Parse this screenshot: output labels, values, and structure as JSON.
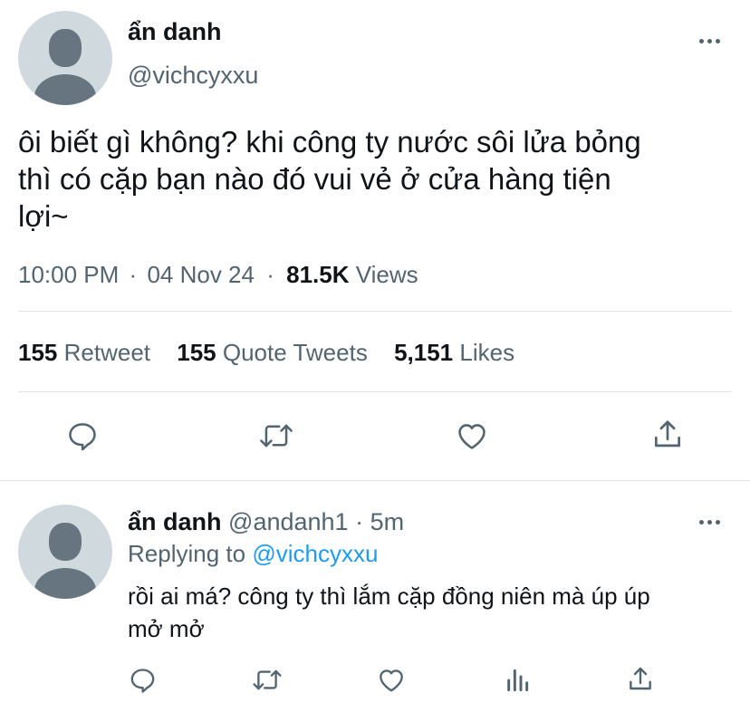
{
  "main_tweet": {
    "display_name": "ẩn danh",
    "handle": "@vichcyxxu",
    "text_line1": "ôi biết gì không? khi công ty nước sôi lửa bỏng",
    "text_line2": "thì có cặp bạn nào đó vui vẻ ở cửa hàng tiện",
    "text_line3": "lợi~",
    "time": "10:00 PM",
    "date": "04 Nov 24",
    "sep": "·",
    "views_count": "81.5K",
    "views_label": "Views",
    "retweets_count": "155",
    "retweets_label": "Retweet",
    "quotes_count": "155",
    "quotes_label": "Quote Tweets",
    "likes_count": "5,151",
    "likes_label": "Likes"
  },
  "reply_tweet": {
    "display_name": "ẩn danh",
    "handle": "@andanh1",
    "sep": "·",
    "time_ago": "5m",
    "replying_to_label": "Replying to",
    "replying_to_handle": "@vichcyxxu",
    "text_line1": "rồi ai má? công ty thì lắm cặp đồng niên mà úp úp",
    "text_line2": "mở mở"
  },
  "icons": [
    "reply-icon",
    "retweet-icon",
    "like-icon",
    "share-icon",
    "views-icon",
    "more-icon",
    "avatar-icon"
  ],
  "colors": {
    "text": "#0f1419",
    "secondary": "#536471",
    "link": "#1d9bf0",
    "avatar_bg": "#cfd9de",
    "avatar_fg": "#66757f",
    "divider": "#dfe3e6"
  }
}
